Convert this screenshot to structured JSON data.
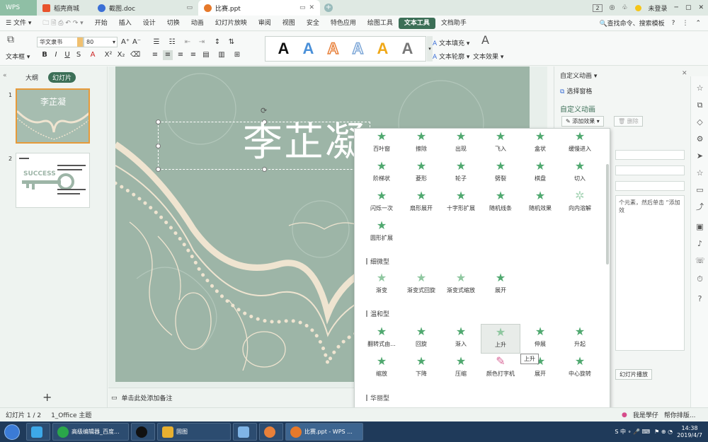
{
  "titlebar": {
    "app_tab": "WPS",
    "tabs": [
      {
        "label": "稻壳商城",
        "color": "#e8532c"
      },
      {
        "label": "截图.doc",
        "color": "#3b6fd6"
      },
      {
        "label": "比赛.ppt",
        "color": "#e6792a"
      }
    ],
    "badge": "2",
    "login": "未登录"
  },
  "menubar": {
    "file": "文件",
    "items": [
      "开始",
      "插入",
      "设计",
      "切换",
      "动画",
      "幻灯片放映",
      "审阅",
      "视图",
      "安全",
      "特色应用",
      "绘图工具",
      "文本工具",
      "文档助手"
    ],
    "active": "文本工具",
    "search": "查找命令、搜索模板"
  },
  "toolbar": {
    "textbox_label": "文本框",
    "font_name": "华文隶书",
    "font_size": "80",
    "text_fill": "文本填充",
    "text_outline": "文本轮廓",
    "text_effect": "文本效果",
    "style_colors": [
      "#111111",
      "#4a90d9",
      "#e8803a",
      "#7fa8d8",
      "#f0a818",
      "#777777"
    ]
  },
  "leftpanel": {
    "tabs": [
      "大纲",
      "幻灯片"
    ],
    "slide1_num": "1",
    "slide2_num": "2",
    "thumb1_title": "李芷凝",
    "thumb2_title": "SUCCESS"
  },
  "slide": {
    "title": "李芷凝"
  },
  "notes": {
    "placeholder": "单击此处添加备注"
  },
  "rightpanel": {
    "header": "自定义动画",
    "select_pane": "选择窗格",
    "custom_anim": "自定义动画",
    "add_effect": "添加效果",
    "delete": "删除",
    "hint": "个元素，然后单击 “添加效",
    "play": "幻灯片播放"
  },
  "anim": {
    "section1": [
      [
        "百叶窗",
        "擦除",
        "出现",
        "飞入",
        "盒状",
        "缓慢进入"
      ],
      [
        "阶梯状",
        "菱形",
        "轮子",
        "劈裂",
        "棋盘",
        "切入"
      ],
      [
        "闪烁一次",
        "扇形展开",
        "十字形扩展",
        "随机线条",
        "随机效果",
        "向内溶解"
      ],
      [
        "圆形扩展"
      ]
    ],
    "heading_subtle": "细微型",
    "subtle": [
      "渐变",
      "渐变式回旋",
      "渐变式缩放",
      "展开"
    ],
    "heading_moderate": "温和型",
    "moderate": [
      [
        "翻转式由...",
        "回旋",
        "渐入",
        "上升",
        "伸展",
        "升起"
      ],
      [
        "缩放",
        "下降",
        "压缩",
        "颜色打字机",
        "展开",
        "中心旋转"
      ]
    ],
    "heading_exciting": "华丽型",
    "tooltip": "上升"
  },
  "status": {
    "slide_info": "幻灯片 1 / 2",
    "theme": "1_Office 主题",
    "user": "我是學仔",
    "help": "帮你排版..."
  },
  "taskbar": {
    "apps": [
      {
        "label": "",
        "color": "#3da8e8"
      },
      {
        "label": "高级编辑器_百度...",
        "color": "#2aa64a"
      },
      {
        "label": "",
        "color": "#111111"
      },
      {
        "label": "固图",
        "color": "#e8b030"
      },
      {
        "label": "",
        "color": "#7fb4e6"
      },
      {
        "label": "",
        "color": "#e8803a"
      },
      {
        "label": "比赛.ppt - WPS ...",
        "color": "#e6792a"
      }
    ],
    "time": "14:38",
    "date": "2019/4/7"
  }
}
